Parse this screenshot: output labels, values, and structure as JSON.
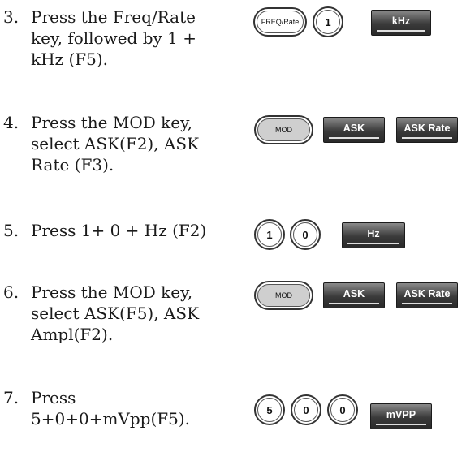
{
  "steps": [
    {
      "number": "3.",
      "lines": [
        "Press the Freq/Rate",
        "key, followed by 1 +",
        "kHz (F5)."
      ]
    },
    {
      "number": "4.",
      "lines": [
        "Press the MOD key,",
        "select ASK(F2), ASK",
        "Rate (F3)."
      ]
    },
    {
      "number": "5.",
      "lines": [
        "Press 1+ 0 + Hz (F2)"
      ]
    },
    {
      "number": "6.",
      "lines": [
        "Press the MOD key,",
        "select ASK(F5), ASK",
        "Ampl(F2)."
      ]
    },
    {
      "number": "7.",
      "lines": [
        "Press",
        "5+0+0+mVpp(F5)."
      ]
    }
  ],
  "keys": {
    "step3": [
      "FREQ/Rate",
      "1",
      "kHz"
    ],
    "step4": [
      "MOD",
      "ASK",
      "ASK Rate"
    ],
    "step5": [
      "1",
      "0",
      "Hz"
    ],
    "step6": [
      "MOD",
      "ASK",
      "ASK Rate"
    ],
    "step7": [
      "5",
      "0",
      "0",
      "mVPP"
    ]
  }
}
